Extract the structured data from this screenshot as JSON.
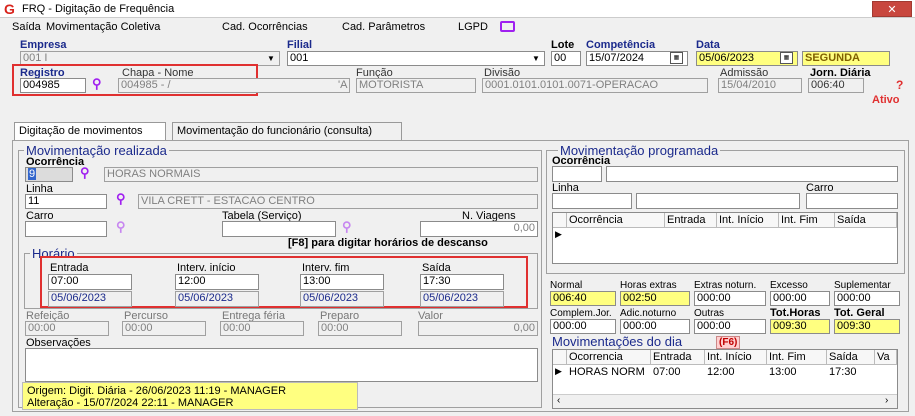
{
  "window": {
    "title": "FRQ - Digitação de Frequência",
    "close_glyph": "✕"
  },
  "menu": [
    {
      "label": "Saída",
      "key": "S"
    },
    {
      "label": "Movimentação Coletiva",
      "key": "M"
    },
    {
      "label": "Cad. Ocorrências",
      "key": "C"
    },
    {
      "label": "Cad. Parâmetros",
      "key": "a"
    },
    {
      "label": "LGPD",
      "key": "L"
    }
  ],
  "header": {
    "empresa_label": "Empresa",
    "empresa_value": "001 I",
    "filial_label": "Filial",
    "filial_value": "001",
    "lote_label": "Lote",
    "lote_value": "00",
    "competencia_label": "Competência",
    "competencia_value": "15/07/2024",
    "data_label": "Data",
    "data_value": "05/06/2023",
    "weekday": "SEGUNDA",
    "registro_label": "Registro",
    "registro_value": "004985",
    "chapa_label": "Chapa - Nome",
    "chapa_value": "004985 - /",
    "chapa_suffix": "'A",
    "funcao_label": "Função",
    "funcao_value": "MOTORISTA",
    "divisao_label": "Divisão",
    "divisao_value": "0001.0101.0101.0071-OPERACAO",
    "admissao_label": "Admissão",
    "admissao_value": "15/04/2010",
    "jornada_label": "Jorn. Diária",
    "jornada_value": "006:40",
    "status": "Ativo",
    "help": "?"
  },
  "tabs": [
    {
      "label": "Digitação de movimentos"
    },
    {
      "label": "Movimentação do funcionário (consulta)"
    }
  ],
  "realizada": {
    "title": "Movimentação realizada",
    "ocorrencia_label": "Ocorrência",
    "ocorrencia_code": "9",
    "ocorrencia_desc": "HORAS NORMAIS",
    "linha_label": "Linha",
    "linha_code": "11",
    "linha_desc": "VILA CRETT - ESTACAO CENTRO",
    "carro_label": "Carro",
    "carro_value": "",
    "tabela_label": "Tabela (Serviço)",
    "tabela_value": "",
    "viagens_label": "N. Viagens",
    "viagens_value": "0,00",
    "hint": "[F8] para digitar horários de descanso"
  },
  "horario": {
    "title": "Horário",
    "cols": [
      {
        "label": "Entrada",
        "time": "07:00",
        "date": "05/06/2023"
      },
      {
        "label": "Interv. início",
        "time": "12:00",
        "date": "05/06/2023"
      },
      {
        "label": "Interv. fim",
        "time": "13:00",
        "date": "05/06/2023"
      },
      {
        "label": "Saída",
        "time": "17:30",
        "date": "05/06/2023"
      }
    ]
  },
  "extras": {
    "refeicao_label": "Refeição",
    "refeicao_value": "00:00",
    "percurso_label": "Percurso",
    "percurso_value": "00:00",
    "entrega_label": "Entrega féria",
    "entrega_value": "00:00",
    "preparo_label": "Preparo",
    "preparo_value": "00:00",
    "valor_label": "Valor",
    "valor_value": "0,00",
    "obs_label": "Observações",
    "obs_value": ""
  },
  "info": {
    "origem": "Origem: Digit. Diária - 26/06/2023 11:19 - MANAGER",
    "alteracao": "Alteração - 15/07/2024 22:11 - MANAGER"
  },
  "programada": {
    "title": "Movimentação programada",
    "ocorrencia_label": "Ocorrência",
    "linha_label": "Linha",
    "carro_label": "Carro",
    "grid_headers": [
      "Ocorrência",
      "Entrada",
      "Int. Início",
      "Int. Fim",
      "Saída"
    ]
  },
  "totals": {
    "row1": [
      {
        "label": "Normal",
        "value": "006:40",
        "hl": true
      },
      {
        "label": "Horas extras",
        "value": "002:50",
        "hl": true
      },
      {
        "label": "Extras noturn.",
        "value": "000:00",
        "hl": false
      },
      {
        "label": "Excesso",
        "value": "000:00",
        "hl": false
      },
      {
        "label": "Suplementar",
        "value": "000:00",
        "hl": false
      }
    ],
    "row2": [
      {
        "label": "Complem.Jor.",
        "value": "000:00",
        "hl": false
      },
      {
        "label": "Adic.noturno",
        "value": "000:00",
        "hl": false
      },
      {
        "label": "Outras",
        "value": "000:00",
        "hl": false
      },
      {
        "label": "Tot.Horas",
        "value": "009:30",
        "hl": true
      },
      {
        "label": "Tot. Geral",
        "value": "009:30",
        "hl": true
      }
    ]
  },
  "dia": {
    "title": "Movimentações do dia",
    "badge": "(F6)",
    "headers": [
      "Ocorrencia",
      "Entrada",
      "Int. Início",
      "Int. Fim",
      "Saída",
      "Va"
    ],
    "rows": [
      [
        "HORAS NORM",
        "07:00",
        "12:00",
        "13:00",
        "17:30",
        ""
      ]
    ]
  },
  "colors": {
    "accent": "#1b2a8c",
    "highlight": "#ffff80",
    "alert": "#e03030",
    "logo": "#d8231c"
  }
}
